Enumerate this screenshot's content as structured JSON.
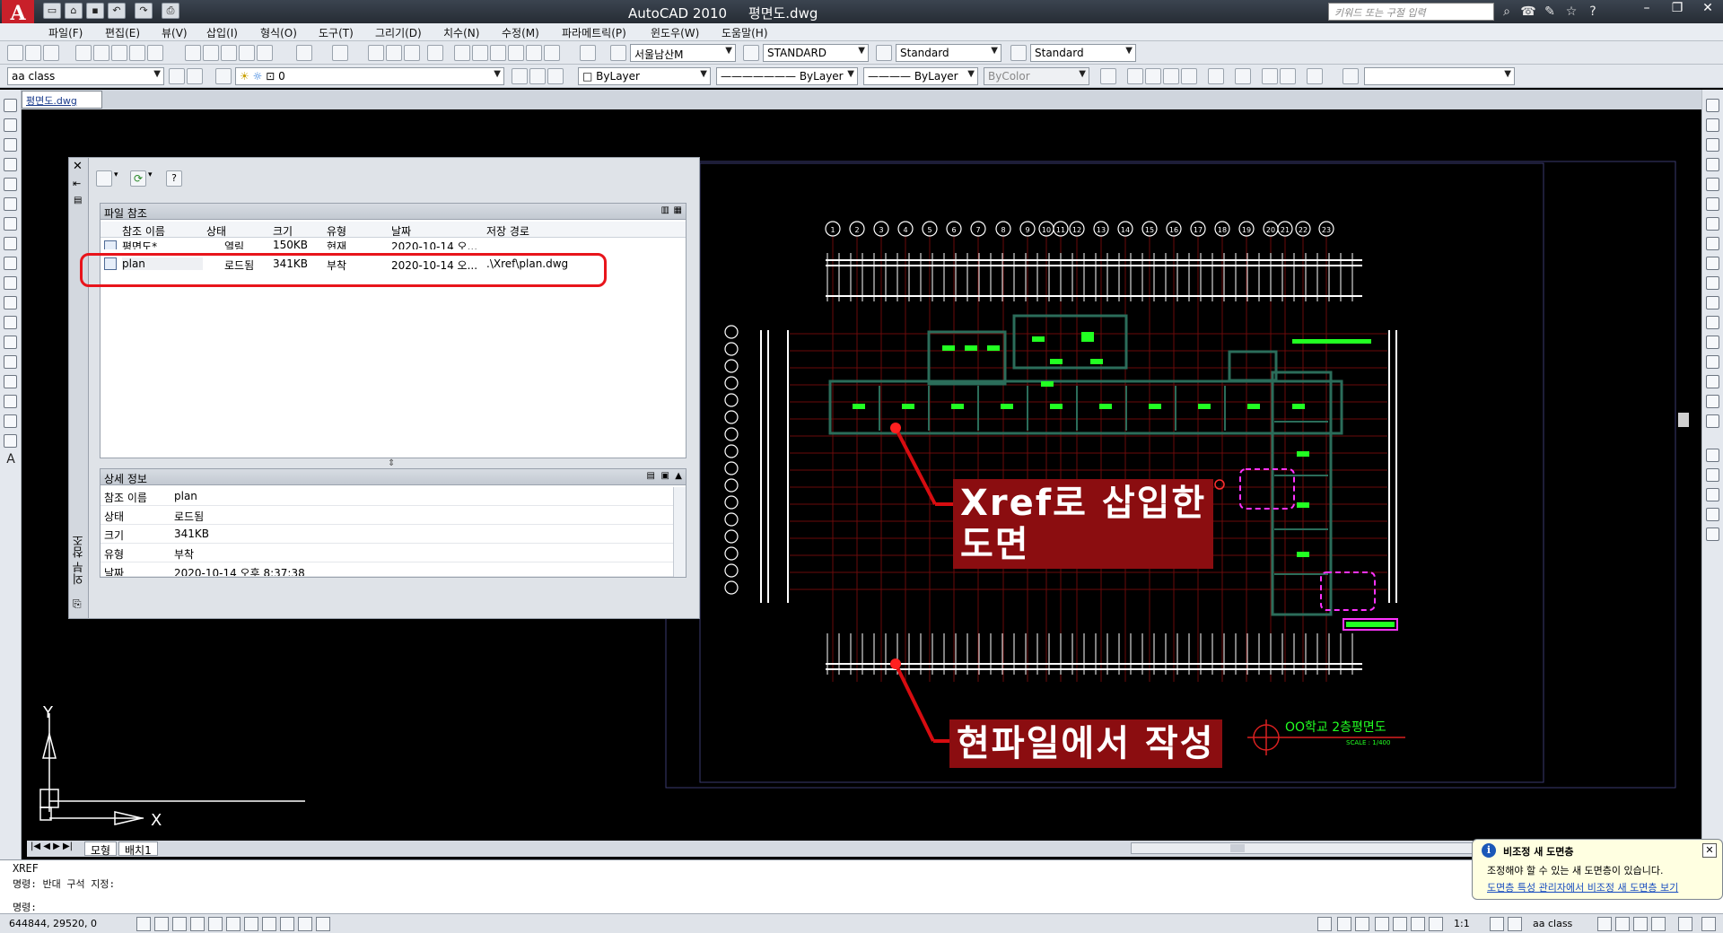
{
  "titlebar": {
    "title": "AutoCAD 2010     평면도.dwg",
    "search_placeholder": "키워드 또는 구절 입력",
    "app_logo_letter": "A"
  },
  "menu": [
    "파일(F)",
    "편집(E)",
    "뷰(V)",
    "삽입(I)",
    "형식(O)",
    "도구(T)",
    "그리기(D)",
    "치수(N)",
    "수정(M)",
    "파라메트릭(P)",
    "윈도우(W)",
    "도움말(H)"
  ],
  "toolbar1": {
    "text_style": "서울남산M",
    "dim_style": "STANDARD",
    "table_style": "Standard",
    "mleader_style": "Standard"
  },
  "toolbar2": {
    "workspace": "aa class",
    "layer": "0",
    "color": "ByLayer",
    "linetype": "ByLayer",
    "lineweight": "ByLayer",
    "plotstyle": "ByColor"
  },
  "doc_tab": "평면도.dwg",
  "xref": {
    "vertical_title": "외부 참조",
    "file_refs_title": "파일 참조",
    "columns": [
      "참조 이름",
      "상태",
      "크기",
      "유형",
      "날짜",
      "저장 경로"
    ],
    "rows": [
      {
        "name": "평면도*",
        "status": "열림",
        "size": "150KB",
        "type": "현재",
        "date": "2020-10-14 오...",
        "path": ""
      },
      {
        "name": "plan",
        "status": "로드됨",
        "size": "341KB",
        "type": "부착",
        "date": "2020-10-14 오...",
        "path": ".\\Xref\\plan.dwg"
      }
    ],
    "details_title": "상세 정보",
    "details": [
      {
        "key": "참조 이름",
        "value": "plan"
      },
      {
        "key": "상태",
        "value": "로드됨"
      },
      {
        "key": "크기",
        "value": "341KB"
      },
      {
        "key": "유형",
        "value": "부착"
      },
      {
        "key": "날짜",
        "value": "2020-10-14 오후 8:37:38"
      }
    ]
  },
  "drawing": {
    "grid_labels": [
      "1",
      "2",
      "3",
      "4",
      "5",
      "6",
      "7",
      "8",
      "9",
      "10",
      "11",
      "12",
      "13",
      "14",
      "15",
      "16",
      "17",
      "18",
      "19",
      "20",
      "21",
      "22",
      "23"
    ],
    "title_block_title": "OO학교 2층평면도",
    "title_block_scale": "SCALE : 1/400",
    "axis_y": "Y",
    "axis_x": "X"
  },
  "annotations": {
    "xref_note": "Xref로 삽입한\n도면",
    "current_note": "현파일에서 작성"
  },
  "tabs": {
    "model": "모형",
    "layout1": "배치1"
  },
  "command": {
    "line1": "XREF",
    "line2": "명령: 반대 구석 지정:",
    "line3": "명령:"
  },
  "status": {
    "coords": "644844, 29520, 0",
    "scale": "1:1",
    "workspace": "aa class"
  },
  "balloon": {
    "title": "비조정 새 도면층",
    "message": "조정해야 할 수 있는 새 도면층이 있습니다.",
    "link": "도면층 특성 관리자에서 비조정 새 도면층 보기"
  },
  "colors": {
    "annotation_bg": "#8b0d10",
    "highlight": "#e8141b",
    "cad_green": "#22ff22",
    "cad_magenta": "#ff33ff"
  }
}
